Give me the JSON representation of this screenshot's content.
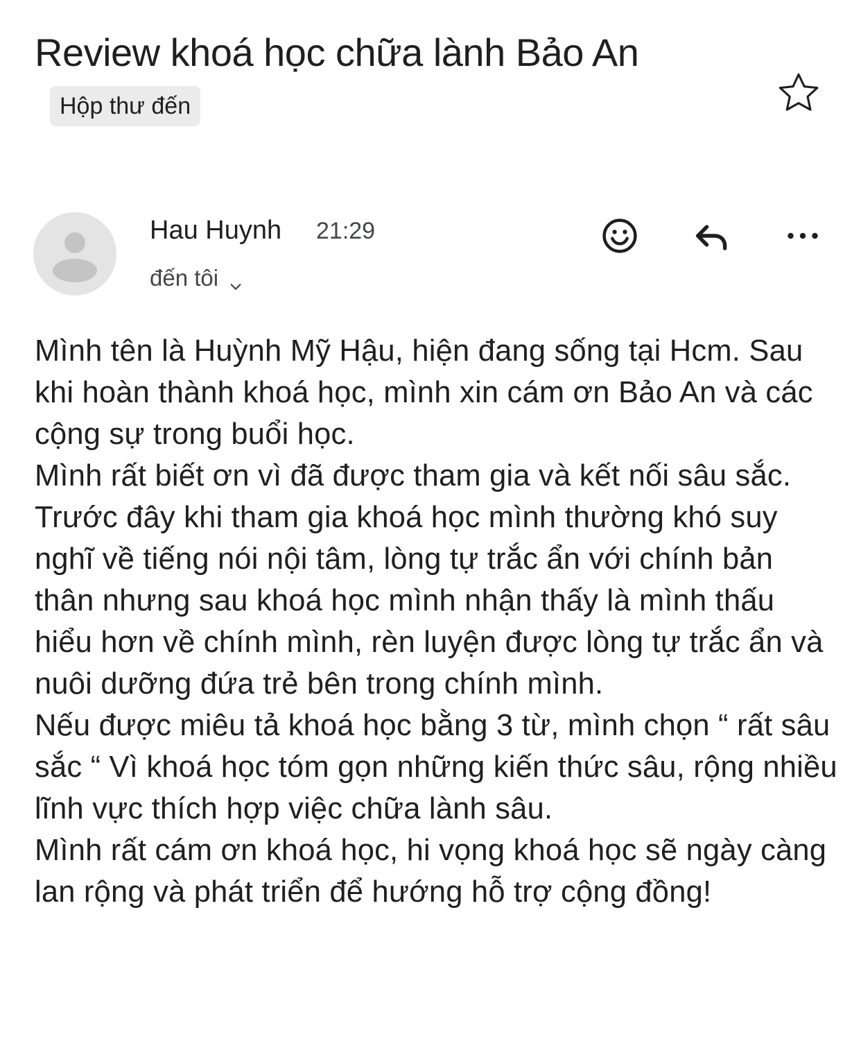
{
  "email": {
    "subject": "Review khoá học chữa lành Bảo An",
    "label": "Hộp thư đến",
    "starred": false
  },
  "icons": {
    "star": "star-outline-icon",
    "avatar": "person-avatar-icon",
    "emoji": "smiley-icon",
    "reply": "reply-arrow-icon",
    "more": "more-horizontal-icon",
    "recipients_toggle": "chevron-down-icon"
  },
  "sender": {
    "name": "Hau Huynh",
    "time": "21:29",
    "recipient_text": "đến tôi"
  },
  "body": {
    "paragraphs": [
      "Mình tên là Huỳnh Mỹ Hậu, hiện đang sống tại Hcm. Sau khi hoàn thành khoá học, mình xin cám ơn Bảo An và các cộng sự trong buổi học.",
      "Mình rất biết ơn vì đã được tham gia và kết nối sâu sắc. Trước đây khi tham gia khoá học mình thường khó suy nghĩ về tiếng nói nội tâm, lòng tự trắc ẩn với chính bản thân nhưng sau khoá học mình nhận thấy là mình thấu hiểu hơn về chính mình, rèn luyện được lòng tự trắc ẩn và nuôi dưỡng đứa trẻ bên trong chính mình.",
      "Nếu được miêu tả khoá học bằng 3 từ, mình chọn “ rất sâu sắc “ Vì khoá học tóm gọn những kiến thức sâu, rộng nhiều lĩnh vực thích hợp việc chữa lành sâu.",
      "Mình rất cám ơn khoá học, hi vọng khoá học sẽ ngày càng lan rộng và phát triển để hướng hỗ trợ cộng đồng!"
    ]
  },
  "colors": {
    "text": "#1f1f1f",
    "secondary_text": "#444746",
    "chip_bg": "#ebebeb",
    "avatar_bg": "#e4e4e4",
    "avatar_figure": "#c4c4c4",
    "icon": "#1f1f1f"
  }
}
